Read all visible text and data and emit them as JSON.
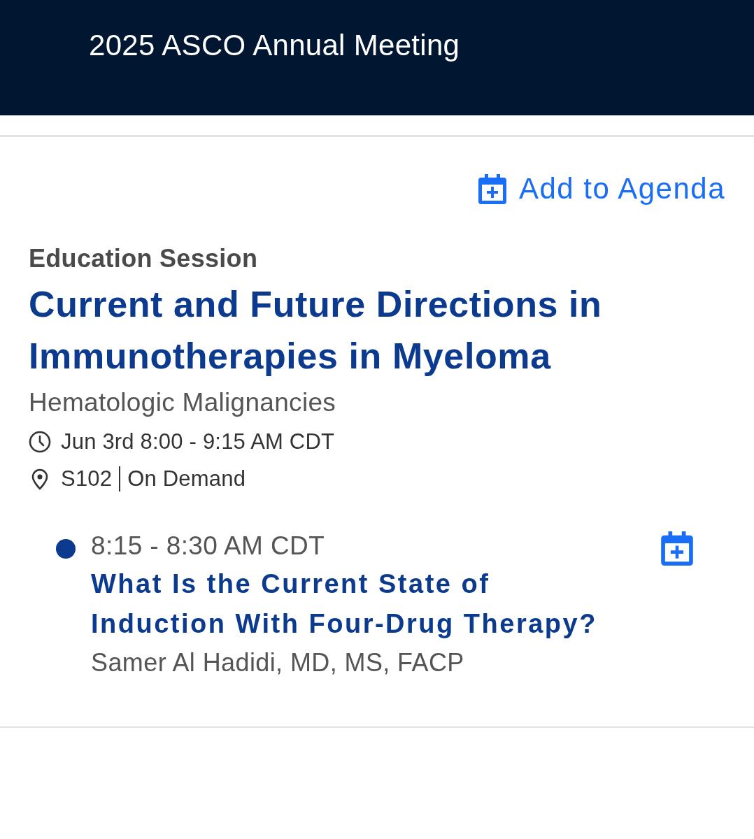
{
  "header": {
    "title": "2025 ASCO Annual Meeting"
  },
  "add_to_agenda": {
    "label": "Add to Agenda"
  },
  "session": {
    "type": "Education Session",
    "title": "Current and Future Directions in Immunotherapies in Myeloma",
    "track": "Hematologic Malignancies",
    "time": "Jun 3rd 8:00 - 9:15 AM CDT",
    "room": "S102",
    "availability": "On Demand"
  },
  "presentations": [
    {
      "time": "8:15 - 8:30 AM CDT",
      "title": "What Is the Current State of Induction With Four-Drug Therapy?",
      "speaker": "Samer Al Hadidi, MD, MS, FACP"
    }
  ]
}
